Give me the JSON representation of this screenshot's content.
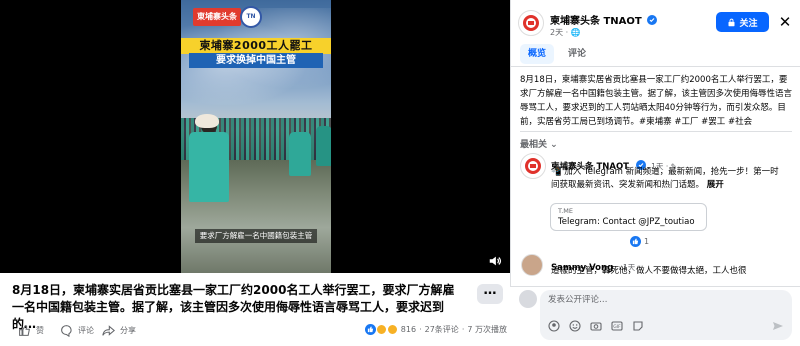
{
  "video": {
    "channel_logo": "東埔寨头条",
    "title_banner": "柬埔寨2000工人罷工",
    "sub_banner": "要求换掉中国主管",
    "caption": "要求厂方解雇一名中國籍包装主管",
    "volume_icon": "volume-icon"
  },
  "post": {
    "text": "8月18日，柬埔寨实居省贡比塞县一家工厂约2000名工人举行罢工，要求厂方解雇一名中国籍包装主管。据了解，该主管因多次使用侮辱性语言辱骂工人，要求迟到的…",
    "more_label": "…",
    "actions": {
      "like": "赞",
      "comment": "评论",
      "share": "分享"
    },
    "stats": {
      "reactions": "816",
      "comments": "27条评论",
      "views": "7 万次播放",
      "separator": "·"
    }
  },
  "panel": {
    "page_name": "柬埔寨头条 TNAOT",
    "meta": "2天 · ",
    "follow_label": "关注",
    "close": "✕",
    "tabs": [
      {
        "label": "概览",
        "active": true
      },
      {
        "label": "评论",
        "active": false
      }
    ],
    "body": "8月18日，柬埔寨实居省贡比塞县一家工厂约2000名工人举行罢工，要求厂方解雇一名中国籍包装主管。据了解，该主管因多次使用侮辱性语言辱骂工人，要求迟到的工人罚站晒太阳40分钟等行为，而引发众怒。目前，实居省劳工局已到场调节。#柬埔寨 #工厂 #罢工 #社会",
    "sort_label": "最相关 ⌄",
    "comments": [
      {
        "name": "柬埔寨头条 TNAOT",
        "time": "1天 · ✎",
        "text": "📲 加入 Telegram 新闻频道，最新新闻，抢先一步！第一时间获取最新资讯、突发新闻和热门话题。",
        "more": "展开",
        "link_domain": "T.ME",
        "link_title": "Telegram: Contact @JPZ_toutiao",
        "reactions": "1"
      },
      {
        "name": "Sammy Vong",
        "time": "· 1天",
        "text": "這樣的主管，轟死他，做人不要做得太絕，工人也很"
      }
    ],
    "composer_placeholder": "发表公开评论…"
  },
  "colors": {
    "brand_blue": "#0866ff",
    "brand_red": "#e0322b",
    "banner_yellow": "#f7d12b",
    "banner_blue": "#1f63b4"
  }
}
